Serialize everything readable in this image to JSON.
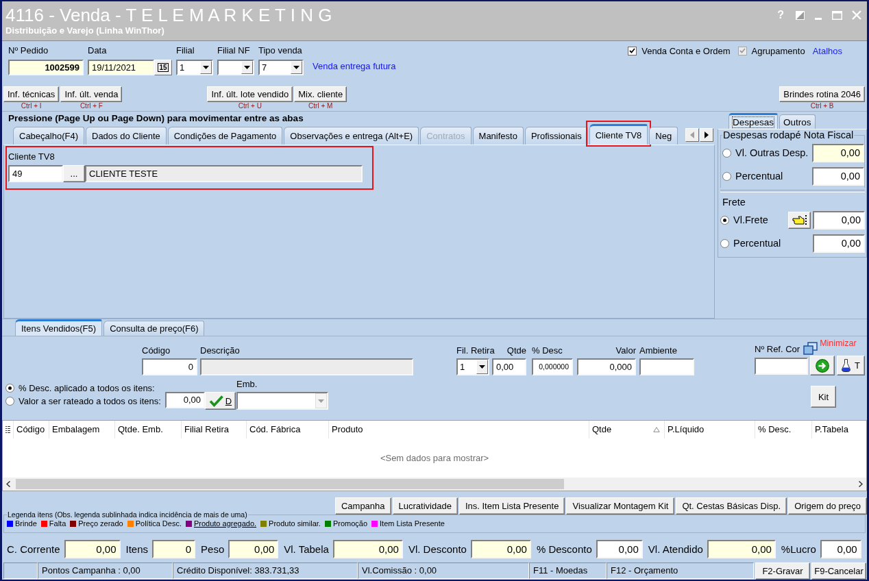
{
  "window": {
    "title": "4116 - Venda - T E L E M A R K E T I N G",
    "subtitle": "Distribuição e Varejo (Linha WinThor)",
    "help": "?"
  },
  "header": {
    "fields": [
      {
        "label": "Nº Pedido",
        "value": "1002599",
        "kind": "number",
        "tinted": true
      },
      {
        "label": "Data",
        "value": "19/11/2021",
        "kind": "date",
        "button": "15",
        "tinted": true
      },
      {
        "label": "Filial",
        "value": "1",
        "kind": "select"
      },
      {
        "label": "Filial NF",
        "kind": "select"
      },
      {
        "label": "Tipo venda",
        "value": "7",
        "kind": "select"
      }
    ],
    "note": "Venda entrega futura",
    "checkboxes": [
      {
        "label": "Venda Conta e Ordem",
        "checked": true,
        "disabled": false
      },
      {
        "label": "Agrupamento",
        "checked": true,
        "disabled": true
      }
    ],
    "link": "Atalhos"
  },
  "toolbar": {
    "left": [
      {
        "label": "Inf. técnicas",
        "shortcut": "Ctrl + I"
      },
      {
        "label": "Inf. últ. venda",
        "shortcut": "Ctrl + F"
      }
    ],
    "middle": [
      {
        "label": "Inf. últ. lote vendido",
        "shortcut": "Ctrl + U"
      },
      {
        "label": "Mix. cliente",
        "shortcut": "Ctrl + M"
      }
    ],
    "right": [
      {
        "label": "Brindes rotina 2046",
        "shortcut": "Ctrl + B"
      }
    ]
  },
  "hint": "Pressione (Page Up ou Page Down) para movimentar entre as abas",
  "main_tabs": [
    {
      "label": "Cabeçalho(F4)",
      "selected": false,
      "disabled": false,
      "highlighted": false
    },
    {
      "label": "Dados do Cliente",
      "selected": false,
      "disabled": false,
      "highlighted": false
    },
    {
      "label": "Condições de Pagamento",
      "selected": false,
      "disabled": false,
      "highlighted": false
    },
    {
      "label": "Observações e entrega (Alt+E)",
      "selected": false,
      "disabled": false,
      "highlighted": false
    },
    {
      "label": "Contratos",
      "selected": false,
      "disabled": true,
      "highlighted": false
    },
    {
      "label": "Manifesto",
      "selected": false,
      "disabled": false,
      "highlighted": false
    },
    {
      "label": "Profissionais",
      "selected": false,
      "disabled": false,
      "highlighted": false
    },
    {
      "label": "Cliente TV8",
      "selected": true,
      "disabled": false,
      "highlighted": true
    },
    {
      "label": "Neg",
      "selected": false,
      "disabled": false,
      "highlighted": false
    }
  ],
  "cliente_tv8": {
    "label": "Cliente TV8",
    "code": "49",
    "browse": "...",
    "name": "CLIENTE TESTE",
    "highlighted": true
  },
  "side_panel": {
    "tabs": [
      {
        "label": "Despesas",
        "selected": true
      },
      {
        "label": "Outros",
        "selected": false
      }
    ],
    "expenses": {
      "title": "Despesas rodapé Nota Fiscal",
      "options": [
        {
          "label": "Vl. Outras Desp.",
          "selected": false,
          "value": "0,00",
          "tinted": true,
          "kind": "plain"
        },
        {
          "label": "Percentual",
          "selected": false,
          "value": "0,00",
          "tinted": false,
          "kind": "plain"
        }
      ]
    },
    "freight": {
      "title": "Frete",
      "options": [
        {
          "label": "Vl.Frete",
          "selected": true,
          "value": "0,00",
          "tinted": false,
          "kind": "with_button"
        },
        {
          "label": "Percentual",
          "selected": false,
          "value": "0,00",
          "tinted": false,
          "kind": "plain"
        }
      ]
    }
  },
  "item_tabs": [
    {
      "label": "Itens Vendidos(F5)",
      "selected": true
    },
    {
      "label": "Consulta de preço(F6)",
      "selected": false
    }
  ],
  "item_entry": {
    "code": {
      "label": "Código",
      "value": "0"
    },
    "description": {
      "label": "Descrição",
      "disabled": true
    },
    "branch": {
      "label": "Fil. Retira",
      "value": "1"
    },
    "quantity": {
      "label": "Qtde",
      "value": "0,00"
    },
    "discount": {
      "label": "% Desc",
      "value": "0,000000"
    },
    "price": {
      "label": "Valor",
      "value": "0,000"
    },
    "environment": {
      "label": "Ambiente"
    },
    "color_ref": {
      "label": "Nº Ref. Cor"
    },
    "minimize": "Minimizar",
    "flask_button": "T",
    "discount_modes": [
      {
        "label": "% Desc. aplicado a todos os itens:",
        "selected": true
      },
      {
        "label": "Valor a ser rateado a todos os itens:",
        "selected": false
      }
    ],
    "apply_value": "0,00",
    "apply_button": "D",
    "packaging": {
      "label": "Emb.",
      "disabled": true
    },
    "kit_button": "Kit"
  },
  "grid": {
    "columns": [
      {
        "label": "Código",
        "sorted": false
      },
      {
        "label": "Embalagem",
        "sorted": false
      },
      {
        "label": "Qtde. Emb.",
        "sorted": false
      },
      {
        "label": "Filial Retira",
        "sorted": false
      },
      {
        "label": "Cód. Fábrica",
        "sorted": false
      },
      {
        "label": "Produto",
        "sorted": false
      },
      {
        "label": "Qtde",
        "sorted": true
      },
      {
        "label": "P.Líquido",
        "sorted": false
      },
      {
        "label": "% Desc.",
        "sorted": false
      },
      {
        "label": "P.Tabela",
        "sorted": false
      }
    ],
    "empty_text": "<Sem dados para mostrar>"
  },
  "actions": [
    "Campanha",
    "Lucratividade",
    "Ins. Item Lista Presente",
    "Visualizar Montagem Kit",
    "Qt. Cestas Básicas Disp.",
    "Origem do preço"
  ],
  "legend": {
    "title": "Legenda itens (Obs. legenda sublinhada indica incidência de mais de uma)",
    "items": [
      {
        "label": "Brinde",
        "color": "#0000ff",
        "underlined": false
      },
      {
        "label": "Falta",
        "color": "#ff0000",
        "underlined": false
      },
      {
        "label": "Preço zerado",
        "color": "#800000",
        "underlined": false
      },
      {
        "label": "Política Desc.",
        "color": "#ff8000",
        "underlined": false
      },
      {
        "label": "Produto agregado.",
        "color": "#800080",
        "underlined": true
      },
      {
        "label": "Produto similar.",
        "color": "#808000",
        "underlined": false
      },
      {
        "label": "Promoção",
        "color": "#008000",
        "underlined": false
      },
      {
        "label": "Item Lista Presente",
        "color": "#ff00ff",
        "underlined": false
      }
    ]
  },
  "totals": [
    {
      "label": "C. Corrente",
      "value": "0,00",
      "tinted": true
    },
    {
      "label": "Itens",
      "value": "0",
      "tinted": true
    },
    {
      "label": "Peso",
      "value": "0,00",
      "tinted": true
    },
    {
      "label": "Vl. Tabela",
      "value": "0,00",
      "tinted": true
    },
    {
      "label": "Vl. Desconto",
      "value": "0,00",
      "tinted": true
    },
    {
      "label": "% Desconto",
      "value": "0,00",
      "tinted": false
    },
    {
      "label": "Vl. Atendido",
      "value": "0,00",
      "tinted": true
    },
    {
      "label": "%Lucro",
      "value": "0,00",
      "tinted": false
    }
  ],
  "status_bar": {
    "cells": [
      "Pontos Campanha : 0,00",
      "Crédito Disponível: 383.731,33",
      "Vl.Comissão : 0,00",
      "F11 - Moedas",
      "F12 - Orçamento"
    ],
    "buttons": [
      "F2-Gravar",
      "F9-Cancelar"
    ]
  }
}
